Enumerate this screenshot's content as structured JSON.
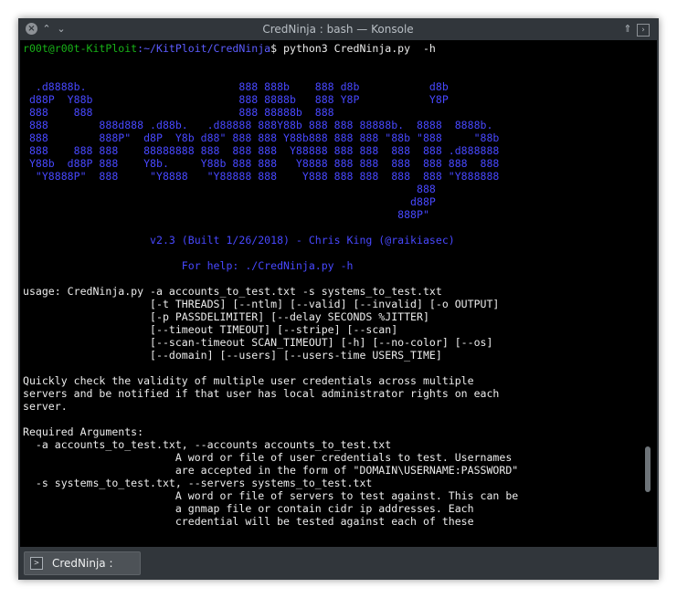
{
  "window": {
    "title": "CredNinja : bash — Konsole",
    "close_glyph": "×",
    "minimize_glyph": "⌃",
    "maximize_glyph": "⌄",
    "keep_above_glyph": "⇑",
    "pin_glyph": "›"
  },
  "terminal": {
    "prompt": {
      "user_host": "r00t@r00t-KitPloit",
      "path": ":~/KitPloit/CredNinja",
      "command": "$ python3 CredNinja.py  -h"
    },
    "banner": [
      "",
      "",
      "  .d8888b.                        888 888b    888 d8b           d8b",
      " d88P  Y88b                       888 8888b   888 Y8P           Y8P",
      " 888    888                       888 88888b  888",
      " 888        888d888 .d88b.   .d88888 888Y88b 888 888 88888b.  8888  8888b.",
      " 888        888P\"  d8P  Y8b d88\" 888 888 Y88b888 888 888 \"88b \"888     \"88b",
      " 888    888 888    88888888 888  888 888  Y88888 888 888  888  888 .d888888",
      " Y88b  d88P 888    Y8b.     Y88b 888 888   Y8888 888 888  888  888 888  888",
      "  \"Y8888P\"  888     \"Y8888   \"Y88888 888    Y888 888 888  888  888 \"Y888888",
      "                                                              888",
      "                                                             d88P",
      "                                                           888P\"",
      "",
      "                    v2.3 (Built 1/26/2018) - Chris King (@raikiasec)",
      "",
      "                         For help: ./CredNinja.py -h",
      ""
    ],
    "help_text": [
      "usage: CredNinja.py -a accounts_to_test.txt -s systems_to_test.txt",
      "                    [-t THREADS] [--ntlm] [--valid] [--invalid] [-o OUTPUT]",
      "                    [-p PASSDELIMITER] [--delay SECONDS %JITTER]",
      "                    [--timeout TIMEOUT] [--stripe] [--scan]",
      "                    [--scan-timeout SCAN_TIMEOUT] [-h] [--no-color] [--os]",
      "                    [--domain] [--users] [--users-time USERS_TIME]",
      "",
      "Quickly check the validity of multiple user credentials across multiple",
      "servers and be notified if that user has local administrator rights on each",
      "server.",
      "",
      "Required Arguments:",
      "  -a accounts_to_test.txt, --accounts accounts_to_test.txt",
      "                        A word or file of user credentials to test. Usernames",
      "                        are accepted in the form of \"DOMAIN\\USERNAME:PASSWORD\"",
      "  -s systems_to_test.txt, --servers systems_to_test.txt",
      "                        A word or file of servers to test against. This can be",
      "                        a gnmap file or contain cidr ip addresses. Each",
      "                        credential will be tested against each of these"
    ]
  },
  "tabs": [
    {
      "label": "CredNinja : bash",
      "icon": "terminal-icon",
      "icon_glyph": ">"
    }
  ],
  "colors": {
    "terminal_bg": "#000000",
    "prompt_user": "#18b218",
    "prompt_path": "#5c5cff",
    "banner_text": "#4848ff",
    "body_text": "#ececec",
    "chrome_bg": "#31363b"
  }
}
